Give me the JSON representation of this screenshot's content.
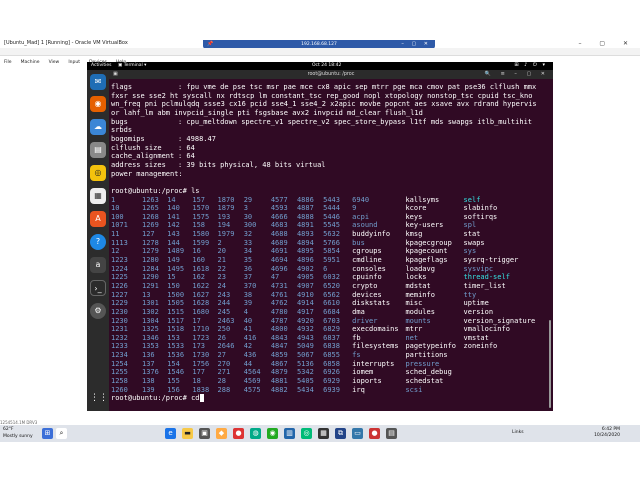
{
  "vbox": {
    "title": "[Ubuntu_Mad] 1 [Running] - Oracle VM VirtualBox",
    "menu": [
      "File",
      "Machine",
      "View",
      "Input",
      "Devices",
      "Help"
    ],
    "rdp_title": "192.168.68.127"
  },
  "gnome": {
    "activities": "Activities",
    "app": "Terminal",
    "clock": "Oct 24  18:42",
    "sys": "⊞ ♪ ⏻ ▾"
  },
  "terminal": {
    "title": "root@ubuntu: /proc",
    "cpuinfo": [
      {
        "k": "flags",
        "v": ": fpu vme de pse tsc msr pae mce cx8 apic sep mtrr pge mca cmov pat pse36 clflush mmx"
      },
      {
        "k": "",
        "v": "fxsr sse sse2 ht syscall nx rdtscp lm constant_tsc rep_good nopl xtopology nonstop_tsc cpuid tsc_kno"
      },
      {
        "k": "",
        "v": "wn_freq pni pclmulqdq ssse3 cx16 pcid sse4_1 sse4_2 x2apic movbe popcnt aes xsave avx rdrand hypervis"
      },
      {
        "k": "",
        "v": "or lahf_lm abm invpcid_single pti fsgsbase avx2 invpcid md_clear flush_l1d"
      },
      {
        "k": "bugs",
        "v": ": cpu_meltdown spectre_v1 spectre_v2 spec_store_bypass l1tf mds swapgs itlb_multihit"
      },
      {
        "k": "",
        "v": "srbds"
      },
      {
        "k": "bogomips",
        "v": ": 4988.47"
      },
      {
        "k": "clflush size",
        "v": ": 64"
      },
      {
        "k": "cache_alignment",
        "v": ": 64"
      },
      {
        "k": "address sizes",
        "v": ": 39 bits physical, 48 bits virtual"
      },
      {
        "k": "power management:",
        "v": ""
      }
    ],
    "prompt_ls": "root@ubuntu:/proc# ls",
    "ls_rows": [
      [
        "1",
        "1263",
        "14",
        "157",
        "1870",
        "29",
        "4577",
        "4886",
        "5443",
        "6940",
        "kallsyms",
        "self"
      ],
      [
        "10",
        "1265",
        "140",
        "1570",
        "1879",
        "3",
        "4593",
        "4887",
        "5444",
        "9",
        "kcore",
        "slabinfo"
      ],
      [
        "100",
        "1268",
        "141",
        "1575",
        "193",
        "30",
        "4666",
        "4888",
        "5446",
        "acpi",
        "keys",
        "softirqs"
      ],
      [
        "1071",
        "1269",
        "142",
        "158",
        "194",
        "300",
        "4683",
        "4891",
        "5545",
        "asound",
        "key-users",
        "spl"
      ],
      [
        "11",
        "127",
        "143",
        "1580",
        "1979",
        "32",
        "4688",
        "4893",
        "5632",
        "buddyinfo",
        "kmsg",
        "stat"
      ],
      [
        "1113",
        "1278",
        "144",
        "1599",
        "2",
        "33",
        "4689",
        "4894",
        "5766",
        "bus",
        "kpagecgroup",
        "swaps"
      ],
      [
        "12",
        "1279",
        "1489",
        "16",
        "20",
        "34",
        "4691",
        "4895",
        "5854",
        "cgroups",
        "kpagecount",
        "sys"
      ],
      [
        "1223",
        "1280",
        "149",
        "160",
        "21",
        "35",
        "4694",
        "4896",
        "5951",
        "cmdline",
        "kpageflags",
        "sysrq-trigger"
      ],
      [
        "1224",
        "1284",
        "1495",
        "1618",
        "22",
        "36",
        "4696",
        "4902",
        "6",
        "consoles",
        "loadavg",
        "sysvipc"
      ],
      [
        "1225",
        "1290",
        "15",
        "162",
        "23",
        "37",
        "47",
        "4905",
        "6032",
        "cpuinfo",
        "locks",
        "thread-self"
      ],
      [
        "1226",
        "1291",
        "150",
        "1622",
        "24",
        "370",
        "4731",
        "4907",
        "6520",
        "crypto",
        "mdstat",
        "timer_list"
      ],
      [
        "1227",
        "13",
        "1500",
        "1627",
        "243",
        "38",
        "4761",
        "4910",
        "6562",
        "devices",
        "meminfo",
        "tty"
      ],
      [
        "1229",
        "1301",
        "1505",
        "1628",
        "244",
        "39",
        "4762",
        "4914",
        "6610",
        "diskstats",
        "misc",
        "uptime"
      ],
      [
        "1230",
        "1302",
        "1515",
        "1680",
        "245",
        "4",
        "4780",
        "4917",
        "6684",
        "dma",
        "modules",
        "version"
      ],
      [
        "1230",
        "1304",
        "1517",
        "17",
        "2463",
        "40",
        "4787",
        "4920",
        "6703",
        "driver",
        "mounts",
        "version_signature"
      ],
      [
        "1231",
        "1325",
        "1518",
        "1710",
        "250",
        "41",
        "4800",
        "4932",
        "6829",
        "execdomains",
        "mtrr",
        "vmallocinfo"
      ],
      [
        "1232",
        "1346",
        "153",
        "1723",
        "26",
        "416",
        "4843",
        "4943",
        "6837",
        "fb",
        "net",
        "vmstat"
      ],
      [
        "1233",
        "1353",
        "1533",
        "173",
        "2646",
        "42",
        "4847",
        "5049",
        "6838",
        "filesystems",
        "pagetypeinfo",
        "zoneinfo"
      ],
      [
        "1234",
        "136",
        "1536",
        "1730",
        "27",
        "436",
        "4859",
        "5067",
        "6855",
        "fs",
        "partitions",
        ""
      ],
      [
        "1254",
        "137",
        "154",
        "1756",
        "270",
        "44",
        "4867",
        "5136",
        "6858",
        "interrupts",
        "pressure",
        ""
      ],
      [
        "1255",
        "1376",
        "1546",
        "177",
        "271",
        "4564",
        "4879",
        "5342",
        "6926",
        "iomem",
        "sched_debug",
        ""
      ],
      [
        "1258",
        "138",
        "155",
        "18",
        "28",
        "4569",
        "4881",
        "5405",
        "6929",
        "ioports",
        "schedstat",
        ""
      ],
      [
        "1260",
        "139",
        "156",
        "1838",
        "288",
        "4575",
        "4882",
        "5434",
        "6939",
        "irq",
        "scsi",
        ""
      ]
    ],
    "blue_cells": [
      "acpi",
      "asound",
      "bus",
      "driver",
      "fs",
      "net",
      "pressure",
      "scsi",
      "mounts",
      "self",
      "thread-self",
      "sys",
      "sysvipc",
      "tty",
      "spl"
    ],
    "prompt_cd": "root@ubuntu:/proc# cd",
    "colors": {
      "bg": "#300a24",
      "dir": "#729fcf"
    }
  },
  "taskbar": {
    "weather_temp": "62°F",
    "weather_text": "Mostly sunny",
    "tray_lang": "Links",
    "time": "6:42 PM",
    "date": "10/24/2020"
  },
  "desktop": {
    "status": "1254514.1M  DRV3"
  }
}
